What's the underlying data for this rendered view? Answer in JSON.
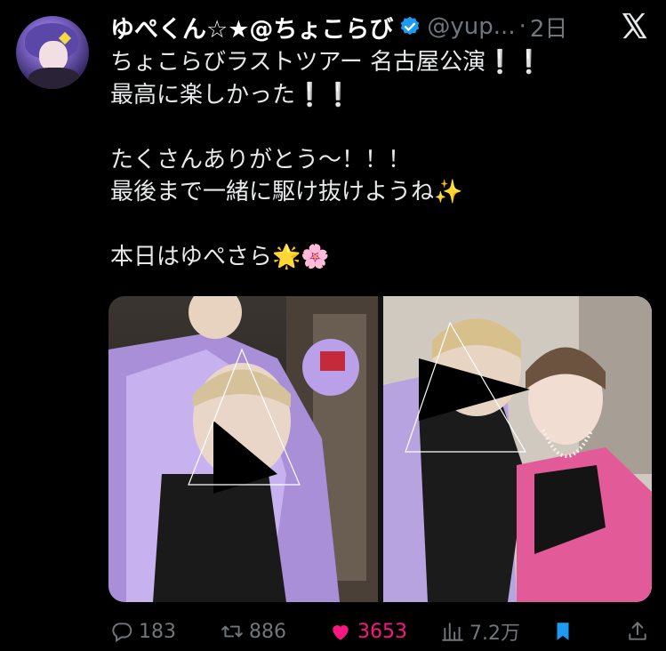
{
  "user": {
    "display_name": "ゆぺくん☆★@ちょこらび",
    "handle": "@yup...",
    "separator": "·",
    "time": "2日"
  },
  "tweet": {
    "lines": [
      "ちょこらびラストツアー 名古屋公演❕❕",
      "最高に楽しかった❕❕",
      "",
      "たくさんありがとう〜！！！",
      "最後まで一緒に駆け抜けようね✨",
      "",
      "本日はゆぺさら🌟🌸"
    ]
  },
  "actions": {
    "replies": "183",
    "retweets": "886",
    "likes": "3653",
    "views": "7.2万"
  },
  "colors": {
    "background": "#000000",
    "text": "#e7e9ea",
    "muted": "#71767b",
    "like": "#f91880",
    "verified": "#1d9bf0",
    "bookmark": "#1d9bf0"
  },
  "icons": [
    "verified-badge-icon",
    "x-logo-icon",
    "reply-icon",
    "retweet-icon",
    "like-icon",
    "views-icon",
    "bookmark-icon",
    "share-icon"
  ]
}
